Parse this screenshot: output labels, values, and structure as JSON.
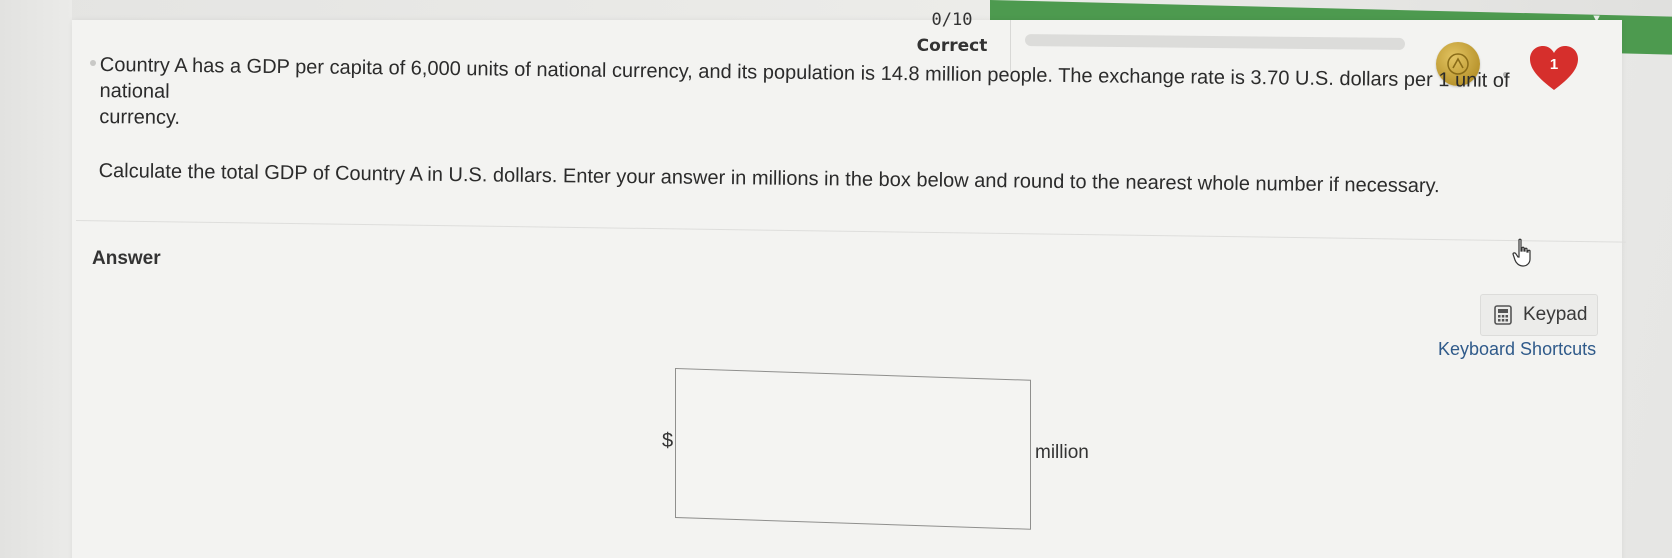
{
  "header": {
    "score_count": "0/10",
    "score_label": "Correct",
    "progress_percent": 0,
    "banner_fragment": "",
    "streak_count": "1"
  },
  "question": {
    "line1": "Country A has a GDP per capita of 6,000 units of national currency, and its population is 14.8 million people. The exchange rate is 3.70 U.S. dollars per 1 unit of national",
    "line2": "currency.",
    "paragraph2": "Calculate the total GDP of Country A in U.S. dollars. Enter your answer in millions in the box below and round to the nearest whole number if necessary."
  },
  "answer": {
    "label": "Answer",
    "currency_prefix": "$",
    "input_value": "",
    "unit_suffix": "million"
  },
  "tools": {
    "keypad_label": "Keypad",
    "shortcuts_label": "Keyboard Shortcuts"
  },
  "colors": {
    "accent_green": "#4d9a4f",
    "heart_red": "#d62f2c",
    "coin_gold": "#c9a53c",
    "link_blue": "#2f5a8a"
  },
  "icons": {
    "coin": "coin-icon",
    "heart": "heart-icon",
    "keypad": "calculator-icon",
    "pointer": "hand-pointer-icon"
  }
}
